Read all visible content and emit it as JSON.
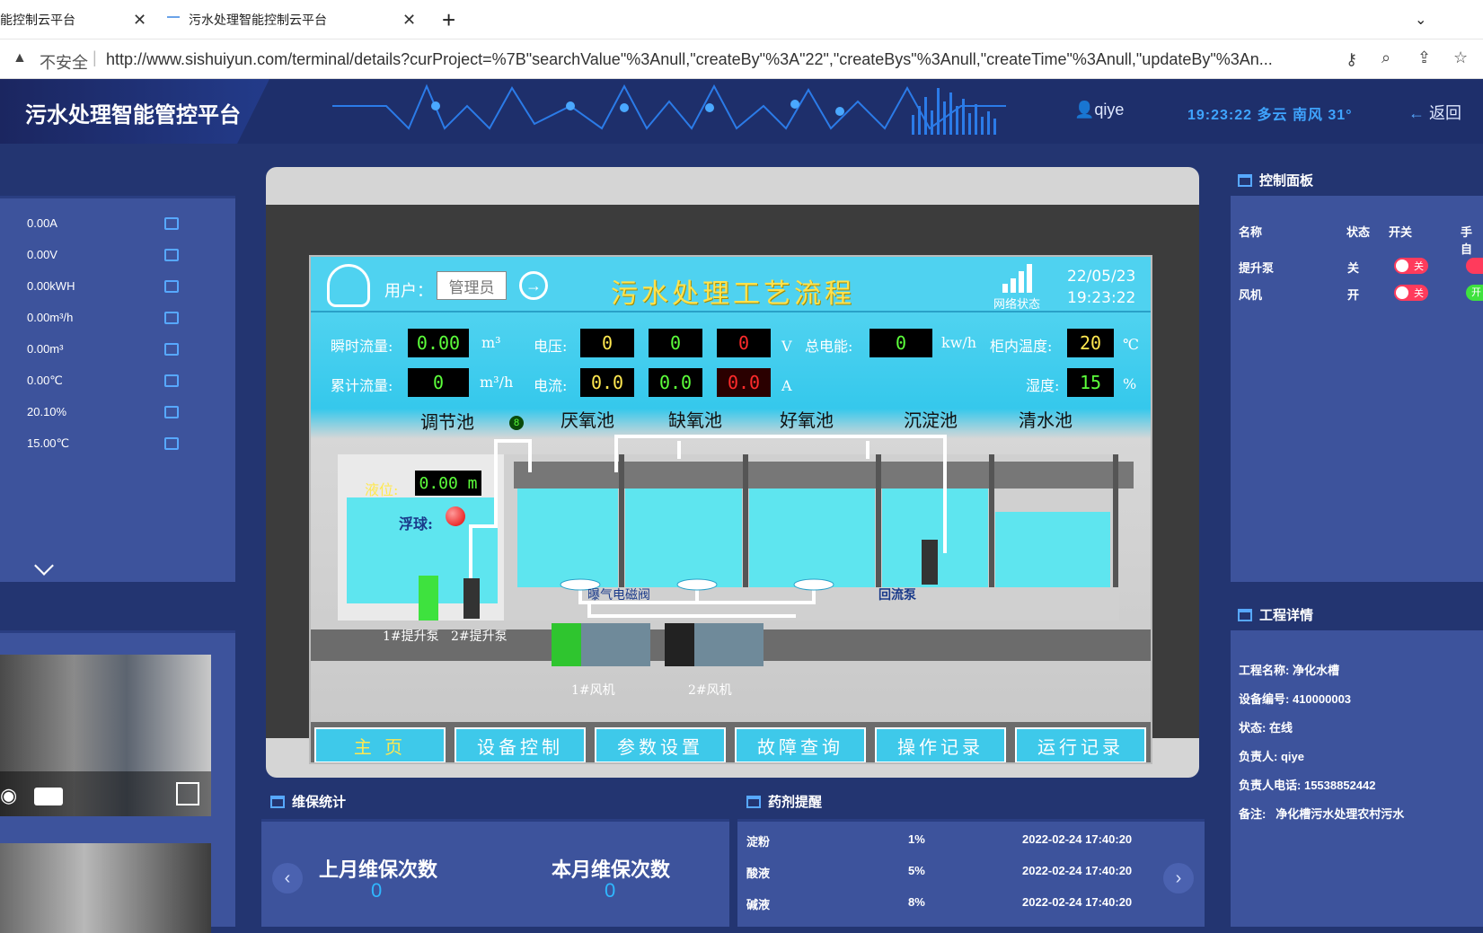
{
  "browser": {
    "tabs": [
      {
        "label": "能控制云平台"
      },
      {
        "label": "污水处理智能控制云平台"
      }
    ],
    "security": "不安全",
    "url": "http://www.sishuiyun.com/terminal/details?curProject=%7B\"searchValue\"%3Anull,\"createBy\"%3A\"22\",\"createBys\"%3Anull,\"createTime\"%3Anull,\"updateBy\"%3An..."
  },
  "header": {
    "title": "污水处理智能管控平台",
    "user": "qiye",
    "weather": "19:23:22  多云  南风  31°",
    "back": "返回"
  },
  "left_panel": {
    "readings": [
      "0.00A",
      "0.00V",
      "0.00kWH",
      "0.00m³/h",
      "0.00m³",
      "0.00℃",
      "20.10%",
      "15.00℃"
    ]
  },
  "control_panel": {
    "title": "控制面板",
    "headers": [
      "名称",
      "状态",
      "开关",
      "手自"
    ],
    "rows": [
      {
        "name": "提升泵",
        "state": "关",
        "switch": "关"
      },
      {
        "name": "风机",
        "state": "开",
        "switch": "关"
      }
    ],
    "extra_switch": "开"
  },
  "project": {
    "title": "工程详情",
    "fields": [
      {
        "label": "工程名称:",
        "value": "净化水槽"
      },
      {
        "label": "设备编号:",
        "value": "410000003"
      },
      {
        "label": "状态:",
        "value": "在线"
      },
      {
        "label": "负责人:",
        "value": "qiye"
      },
      {
        "label": "负责人电话:",
        "value": "15538852442"
      },
      {
        "label": "备注:",
        "value": "净化槽污水处理农村污水"
      }
    ]
  },
  "hmi": {
    "user_label": "用户：",
    "user": "管理员",
    "title": "污水处理工艺流程",
    "network": "网络状态",
    "date": "22/05/23",
    "time": "19:23:22",
    "inst_flow_label": "瞬时流量:",
    "inst_flow": "0.00",
    "inst_flow_unit": "m³",
    "cum_flow_label": "累计流量:",
    "cum_flow": "0",
    "cum_flow_unit": "m³/h",
    "voltage_label": "电压:",
    "voltage": [
      "0",
      "0",
      "0"
    ],
    "voltage_unit": "V",
    "current_label": "电流:",
    "current": [
      "0.0",
      "0.0",
      "0.0"
    ],
    "current_unit": "A",
    "energy_label": "总电能:",
    "energy": "0",
    "energy_unit": "kw/h",
    "cab_temp_label": "柜内温度:",
    "cab_temp": "20",
    "cab_temp_unit": "℃",
    "humidity_label": "湿度:",
    "humidity": "15",
    "humidity_unit": "%",
    "tanks": [
      "调节池",
      "厌氧池",
      "缺氧池",
      "好氧池",
      "沉淀池",
      "清水池"
    ],
    "level_label": "液位:",
    "level": "0.00 m",
    "float_label": "浮球:",
    "valve_label": "曝气电磁阀",
    "return_pump": "回流泵",
    "pump1": "1#提升泵",
    "pump2": "2#提升泵",
    "fan1": "1#风机",
    "fan2": "2#风机",
    "small_badge": "8",
    "nav": [
      "主 页",
      "设备控制",
      "参数设置",
      "故障查询",
      "操作记录",
      "运行记录"
    ]
  },
  "maintenance": {
    "title": "维保统计",
    "last_month_label": "上月维保次数",
    "last_month": "0",
    "this_month_label": "本月维保次数",
    "this_month": "0"
  },
  "chemicals": {
    "title": "药剂提醒",
    "rows": [
      {
        "name": "淀粉",
        "pct": "1%",
        "time": "2022-02-24 17:40:20"
      },
      {
        "name": "酸液",
        "pct": "5%",
        "time": "2022-02-24 17:40:20"
      },
      {
        "name": "碱液",
        "pct": "8%",
        "time": "2022-02-24 17:40:20"
      }
    ]
  }
}
